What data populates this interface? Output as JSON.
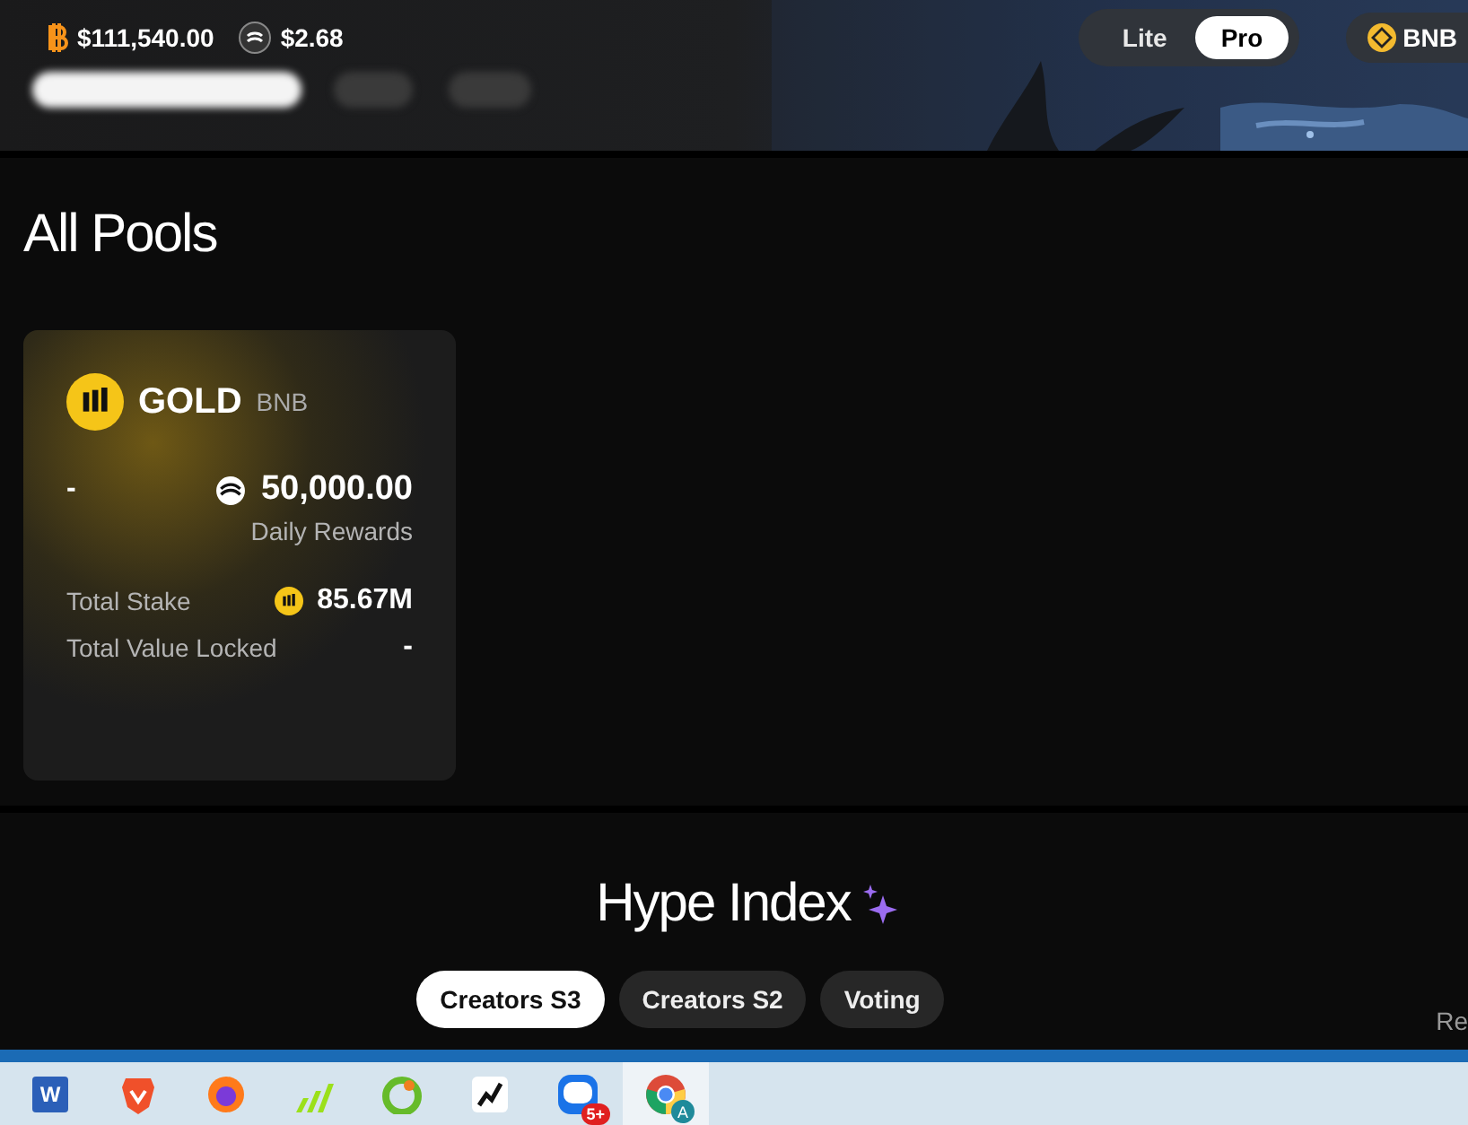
{
  "header": {
    "prices": [
      {
        "kind": "btc",
        "value": "$111,540.00"
      },
      {
        "kind": "token",
        "value": "$2.68"
      }
    ],
    "mode_toggle": [
      {
        "label": "Lite",
        "selected": false
      },
      {
        "label": "Pro",
        "selected": true
      }
    ],
    "network": "BNB"
  },
  "pools": {
    "title": "All Pools",
    "cards": [
      {
        "name": "GOLD",
        "chain": "BNB",
        "apr": "-",
        "rewards": "50,000.00",
        "rewards_label": "Daily Rewards",
        "stake_label": "Total Stake",
        "stake": "85.67M",
        "tvl_label": "Total Value Locked",
        "tvl": "-"
      }
    ]
  },
  "hype": {
    "title": "Hype Index",
    "tabs": [
      {
        "label": "Creators S3",
        "selected": true
      },
      {
        "label": "Creators S2",
        "selected": false
      },
      {
        "label": "Voting",
        "selected": false
      }
    ],
    "right_text": "Re"
  },
  "taskbar": {
    "apps": [
      {
        "kind": "word",
        "label": "W"
      },
      {
        "kind": "brave"
      },
      {
        "kind": "firefox"
      },
      {
        "kind": "bars"
      },
      {
        "kind": "coccoc"
      },
      {
        "kind": "trading"
      },
      {
        "kind": "zalo",
        "badge": "5+"
      },
      {
        "kind": "chrome",
        "avatar": "A",
        "selected": true
      }
    ]
  }
}
